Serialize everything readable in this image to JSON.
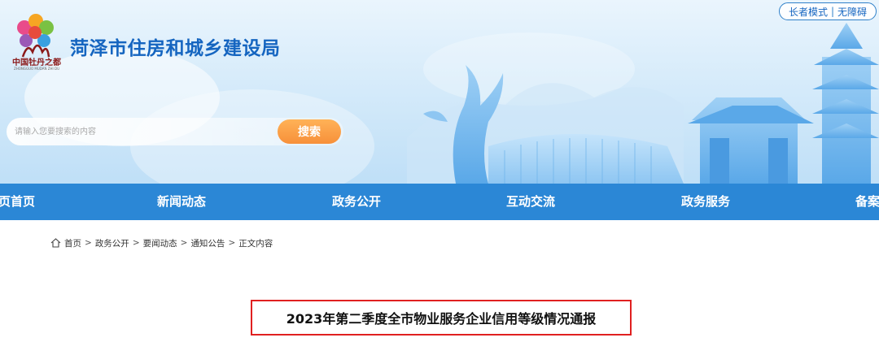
{
  "header": {
    "site_title": "菏泽市住房和城乡建设局",
    "logo_text": "中国牡丹之都",
    "logo_subtext": "ZHONGGUO MUDAN ZHI DU",
    "accessibility": {
      "elder_mode": "长者模式",
      "separator": "|",
      "barrier_free": "无障碍"
    }
  },
  "search": {
    "placeholder": "请输入您要搜索的内容",
    "button_label": "搜索"
  },
  "nav": {
    "items": [
      {
        "label": "页首页"
      },
      {
        "label": "新闻动态"
      },
      {
        "label": "政务公开"
      },
      {
        "label": "互动交流"
      },
      {
        "label": "政务服务"
      },
      {
        "label": "备案"
      }
    ]
  },
  "breadcrumb": {
    "items": [
      {
        "label": "首页"
      },
      {
        "label": "政务公开"
      },
      {
        "label": "要闻动态"
      },
      {
        "label": "通知公告"
      },
      {
        "label": "正文内容"
      }
    ],
    "separator": ">"
  },
  "article": {
    "title": "2023年第二季度全市物业服务企业信用等级情况通报"
  },
  "colors": {
    "nav_bg": "#2b87d6",
    "title_blue": "#1565c0",
    "search_btn": "#f7903a",
    "highlight_border": "#e02020"
  }
}
